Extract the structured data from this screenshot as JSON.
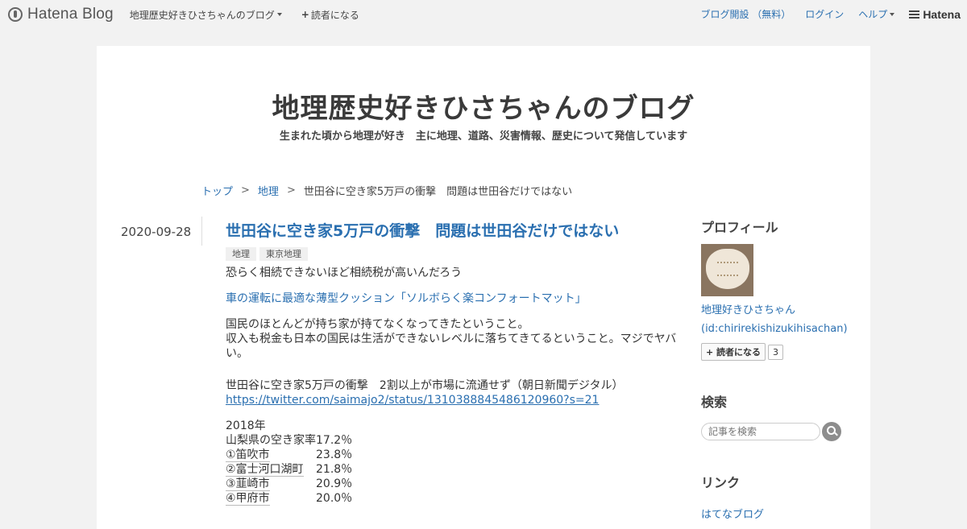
{
  "globalbar": {
    "logo_text": "Hatena Blog",
    "blog_menu": "地理歴史好きひさちゃんのブログ",
    "subscribe": "読者になる",
    "open_blog": "ブログ開設 （無料）",
    "login": "ログイン",
    "help": "ヘルプ",
    "brand": "Hatena"
  },
  "header": {
    "title": "地理歴史好きひさちゃんのブログ",
    "description": "生まれた頃から地理が好き　主に地理、道路、災害情報、歴史について発信しています"
  },
  "breadcrumb": {
    "items": [
      "トップ",
      "地理",
      "世田谷に空き家5万戸の衝撃　問題は世田谷だけではない"
    ],
    "sep": ">"
  },
  "entry": {
    "date": "2020-09-28",
    "title": "世田谷に空き家5万戸の衝撃　問題は世田谷だけではない",
    "tags": [
      "地理",
      "東京地理"
    ],
    "lead": "恐らく相続できないほど相続税が高いんだろう",
    "promo_link": "車の運転に最適な薄型クッション「ソルボらく楽コンフォートマット」",
    "para1": "国民のほとんどが持ち家が持てなくなってきたということ。",
    "para2": "収入も税金も日本の国民は生活ができないレベルに落ちてきてるということ。マジでヤバい。",
    "quote": "世田谷に空き家5万戸の衝撃　2割以上が市場に流通せず（朝日新聞デジタル）",
    "twitter_url": "https://twitter.com/saimajo2/status/1310388845486120960?s=21",
    "year": "2018年",
    "stats": [
      {
        "k": "山梨県の空き家率",
        "v": "17.2％"
      },
      {
        "k": "①笛吹市",
        "v": "23.8％"
      },
      {
        "k": "②富士河口湖町",
        "v": "21.8％"
      },
      {
        "k": "③韮崎市",
        "v": "20.9％"
      },
      {
        "k": "④甲府市",
        "v": "20.0％"
      }
    ]
  },
  "sidebar": {
    "profile_title": "プロフィール",
    "profile_name": "地理好きひさちゃん",
    "profile_id": "(id:chirirekishizukihisachan)",
    "subscribe": "読者になる",
    "subscriber_count": "3",
    "search_title": "検索",
    "search_placeholder": "記事を検索",
    "links_title": "リンク",
    "link_item": "はてなブログ"
  }
}
